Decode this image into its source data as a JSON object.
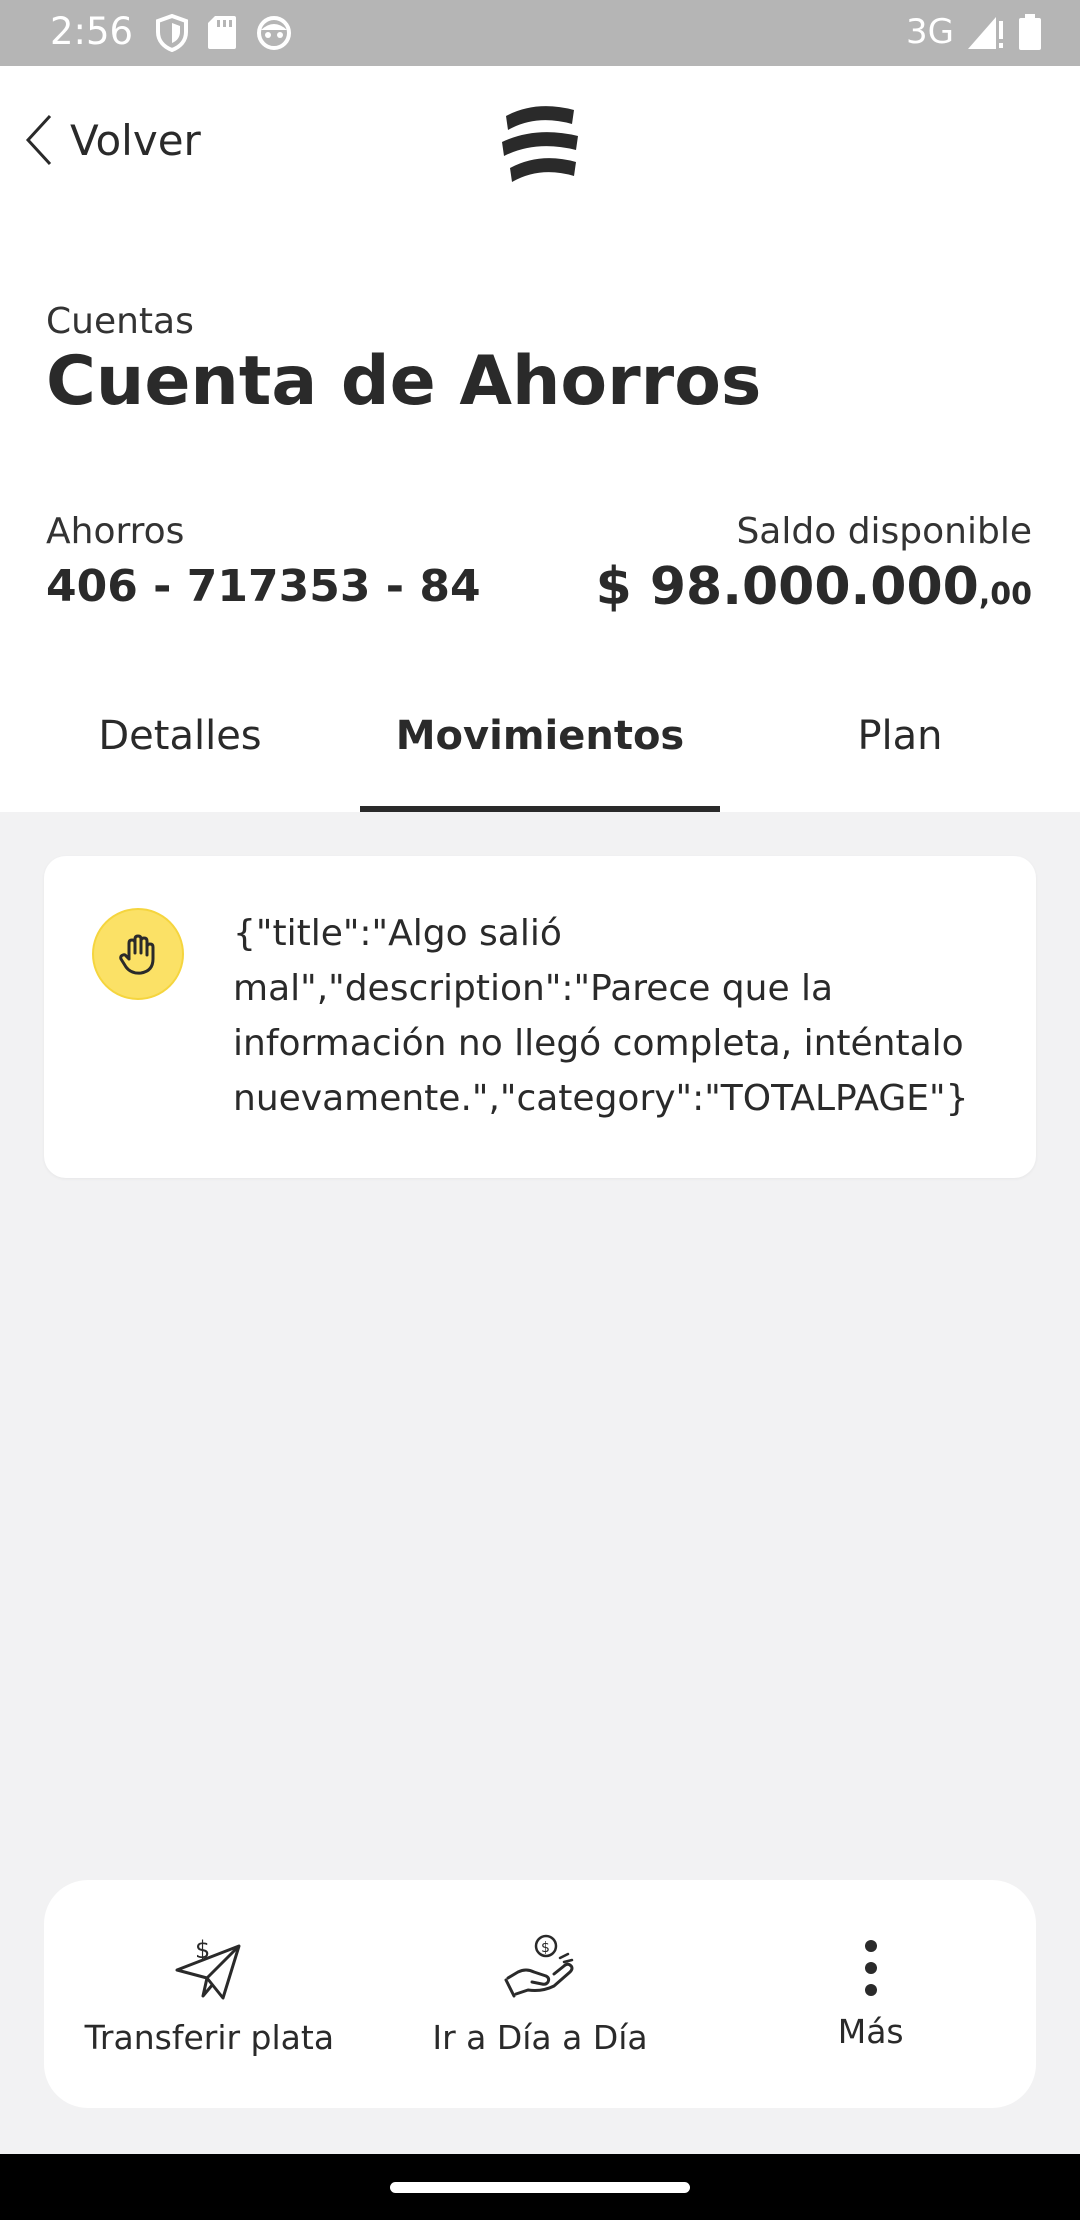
{
  "status_bar": {
    "time": "2:56",
    "network": "3G",
    "left_icons": [
      "shield-icon",
      "sd-card-icon",
      "android-face-icon"
    ],
    "right_icons": [
      "signal-icon",
      "battery-icon"
    ]
  },
  "header": {
    "back_label": "Volver",
    "logo_icon": "bank-logo-icon"
  },
  "account": {
    "section_label": "Cuentas",
    "title": "Cuenta de Ahorros",
    "type_label": "Ahorros",
    "number": "406 - 717353 - 84",
    "balance_label": "Saldo disponible",
    "balance_main": "$ 98.000.000",
    "balance_cents": ",00"
  },
  "tabs": [
    {
      "label": "Detalles",
      "active": false
    },
    {
      "label": "Movimientos",
      "active": true
    },
    {
      "label": "Plan",
      "active": false
    }
  ],
  "error": {
    "icon": "hand-stop-icon",
    "message": "{\"title\":\"Algo salió mal\",\"description\":\"Parece que la información no llegó completa, inténtalo nuevamente.\",\"category\":\"TOTALPAGE\"}"
  },
  "actions": [
    {
      "label": "Transferir plata",
      "icon": "paper-plane-money-icon"
    },
    {
      "label": "Ir a Día a Día",
      "icon": "hand-coin-icon"
    },
    {
      "label": "Más",
      "icon": "more-vertical-icon"
    }
  ],
  "colors": {
    "status_bar": "#b5b5b5",
    "text": "#2a2a2a",
    "background": "#f2f2f3",
    "accent_yellow": "#fbe166"
  }
}
